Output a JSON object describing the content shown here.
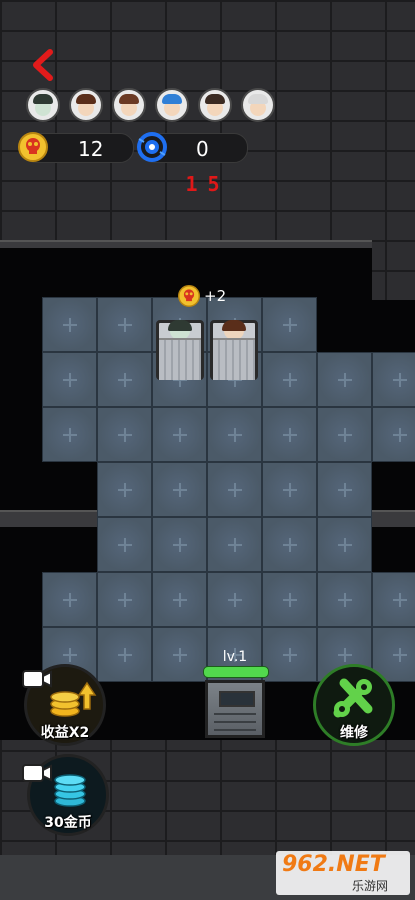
{
  "hud": {
    "skull_count": "12",
    "energy_count": "0",
    "timer": "15",
    "bonus": "+2"
  },
  "avatars": [
    {
      "name": "ghost-green",
      "hair": "#2f3a33",
      "skin": "#cfe3d3"
    },
    {
      "name": "brown-hair-boy",
      "hair": "#5a2e1a",
      "skin": "#f3d6bb"
    },
    {
      "name": "brown-hair-girl",
      "hair": "#6b3a24",
      "skin": "#f3d6bb"
    },
    {
      "name": "blue-hair",
      "hair": "#2f7fd6",
      "skin": "#f3d6bb"
    },
    {
      "name": "dark-hair",
      "hair": "#3a2a22",
      "skin": "#f3d6bb"
    },
    {
      "name": "old-man-glasses",
      "hair": "#d8d8d8",
      "skin": "#f3d6bb"
    }
  ],
  "door": {
    "level_label": "lv.1"
  },
  "buttons": {
    "double_income_label": "收益X2",
    "coins_label": "30金币",
    "repair_label": "维修"
  },
  "watermark": {
    "top": "962.NET",
    "bottom": "乐游网"
  },
  "colors": {
    "accent_red": "#e01818",
    "accent_green": "#52d94d",
    "coin_gold": "#f2c12e",
    "energy_blue": "#1f6ff0"
  }
}
